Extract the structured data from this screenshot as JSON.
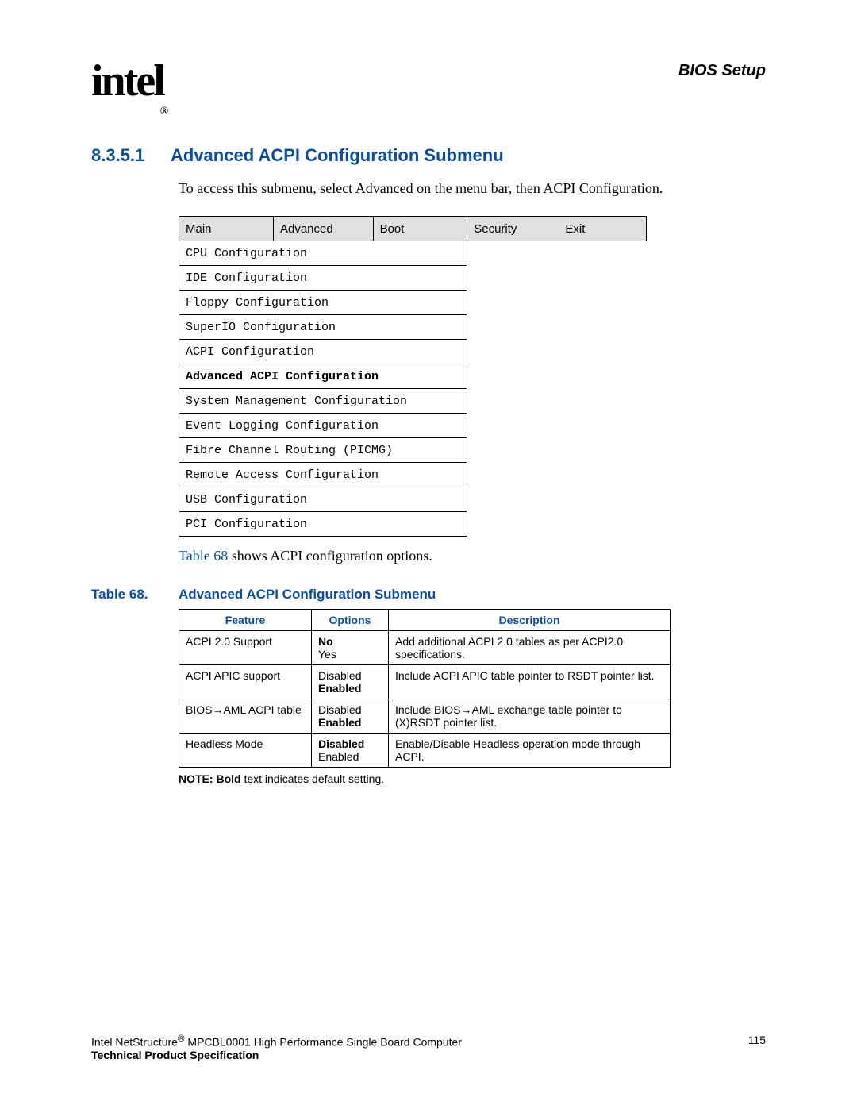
{
  "header": {
    "logo_text": "intel",
    "logo_sub": "®",
    "right": "BIOS Setup"
  },
  "section": {
    "number": "8.3.5.1",
    "title": "Advanced ACPI Configuration Submenu"
  },
  "intro_text": "To access this submenu, select Advanced on the menu bar, then ACPI Configuration.",
  "menu_bar": {
    "items": [
      "Main",
      "Advanced",
      "Boot",
      "Security",
      "Exit"
    ]
  },
  "menu_list": [
    "CPU Configuration",
    "IDE Configuration",
    "Floppy Configuration",
    "SuperIO Configuration",
    "ACPI Configuration",
    "Advanced ACPI Configuration",
    "System Management Configuration",
    "Event Logging Configuration",
    "Fibre Channel Routing (PICMG)",
    "Remote Access Configuration",
    "USB Configuration",
    "PCI Configuration"
  ],
  "menu_list_bold_index": 5,
  "pre_table_text_prefix": "Table 68",
  "pre_table_text_suffix": " shows ACPI configuration options.",
  "table_caption": {
    "label": "Table 68.",
    "title": "Advanced ACPI Configuration Submenu"
  },
  "config_headers": [
    "Feature",
    "Options",
    "Description"
  ],
  "config_rows": [
    {
      "feature": "ACPI 2.0 Support",
      "opt1": "No",
      "opt1_bold": true,
      "opt2": "Yes",
      "opt2_bold": false,
      "desc": "Add additional ACPI 2.0 tables as per ACPI2.0 specifications."
    },
    {
      "feature": "ACPI APIC support",
      "opt1": "Disabled",
      "opt1_bold": false,
      "opt2": "Enabled",
      "opt2_bold": true,
      "desc": "Include ACPI APIC table pointer to RSDT pointer list."
    },
    {
      "feature": "BIOS→AML ACPI table",
      "opt1": "Disabled",
      "opt1_bold": false,
      "opt2": "Enabled",
      "opt2_bold": true,
      "desc": "Include BIOS→AML exchange table pointer to (X)RSDT pointer list."
    },
    {
      "feature": "Headless Mode",
      "opt1": "Disabled",
      "opt1_bold": true,
      "opt2": "Enabled",
      "opt2_bold": false,
      "desc": "Enable/Disable Headless operation mode through ACPI."
    }
  ],
  "note_label": "NOTE:",
  "note_bold_word": "Bold",
  "note_rest": " text indicates default setting.",
  "footer": {
    "line1_prefix": "Intel NetStructure",
    "line1_sup": "®",
    "line1_suffix": " MPCBL0001 High Performance Single Board Computer",
    "line2": "Technical Product Specification",
    "page": "115"
  }
}
